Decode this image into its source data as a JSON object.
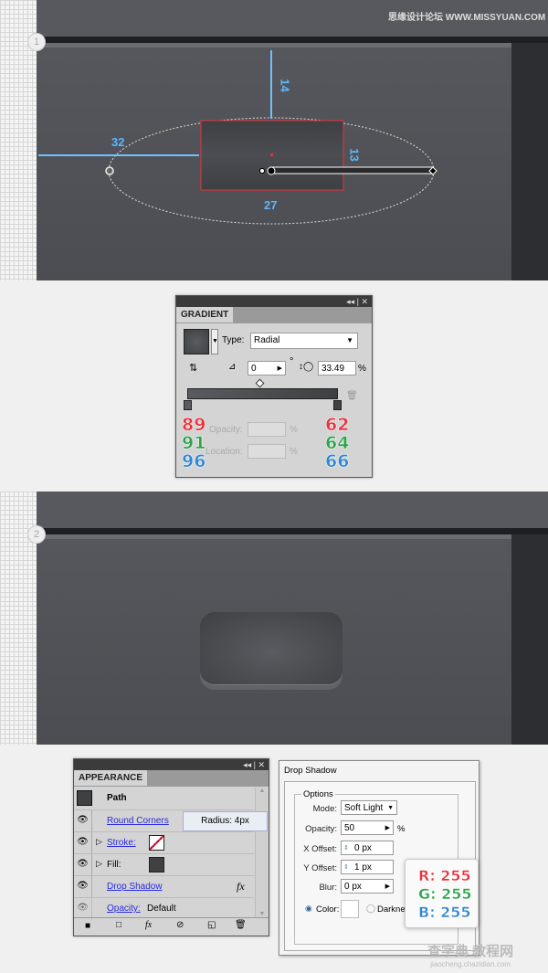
{
  "watermark_top": "思缘设计论坛 WWW.MISSYUAN.COM",
  "watermark_bottom": {
    "cn": "查字典 教程网",
    "url": "jiaocheng.chazidian.com"
  },
  "step1": {
    "badge": "1",
    "measures": {
      "top": "14",
      "left": "32",
      "right": "13",
      "bottom": "27"
    }
  },
  "step2": {
    "badge": "2"
  },
  "gradient_panel": {
    "title": "GRADIENT",
    "type_label": "Type:",
    "type_value": "Radial",
    "angle": "0",
    "angle_unit": "°",
    "aspect": "33.49",
    "aspect_unit": "%",
    "opacity_label": "Opacity:",
    "location_label": "Location:",
    "pct": "%",
    "left_stop": {
      "r": "89",
      "g": "91",
      "b": "96"
    },
    "right_stop": {
      "r": "62",
      "g": "64",
      "b": "66"
    }
  },
  "appearance_panel": {
    "title": "APPEARANCE",
    "path_label": "Path",
    "items": [
      {
        "label": "Round Corners",
        "icon": "eye-icon"
      },
      {
        "label": "Stroke:",
        "icon": "eye-icon"
      },
      {
        "label": "Fill:",
        "icon": "eye-icon"
      },
      {
        "label": "Drop Shadow",
        "fx": "fx",
        "icon": "eye-icon"
      },
      {
        "label": "Opacity:",
        "value": "Default",
        "icon": "eye-icon"
      }
    ],
    "tooltip": "Radius: 4px"
  },
  "drop_shadow": {
    "title": "Drop Shadow",
    "group": "Options",
    "mode_label": "Mode:",
    "mode": "Soft Light",
    "opacity_label": "Opacity:",
    "opacity": "50",
    "opacity_unit": "%",
    "x_label": "X Offset:",
    "x": "0 px",
    "y_label": "Y Offset:",
    "y": "1 px",
    "blur_label": "Blur:",
    "blur": "0 px",
    "color_label": "Color:",
    "darkness_label": "Darknes"
  },
  "rgb_tooltip": {
    "r": "R: 255",
    "g": "G: 255",
    "b": "B: 255"
  },
  "colors": {
    "red": "#e8323c",
    "green": "#2ba34a",
    "blue": "#2f86d0",
    "canvas": "#505156"
  }
}
